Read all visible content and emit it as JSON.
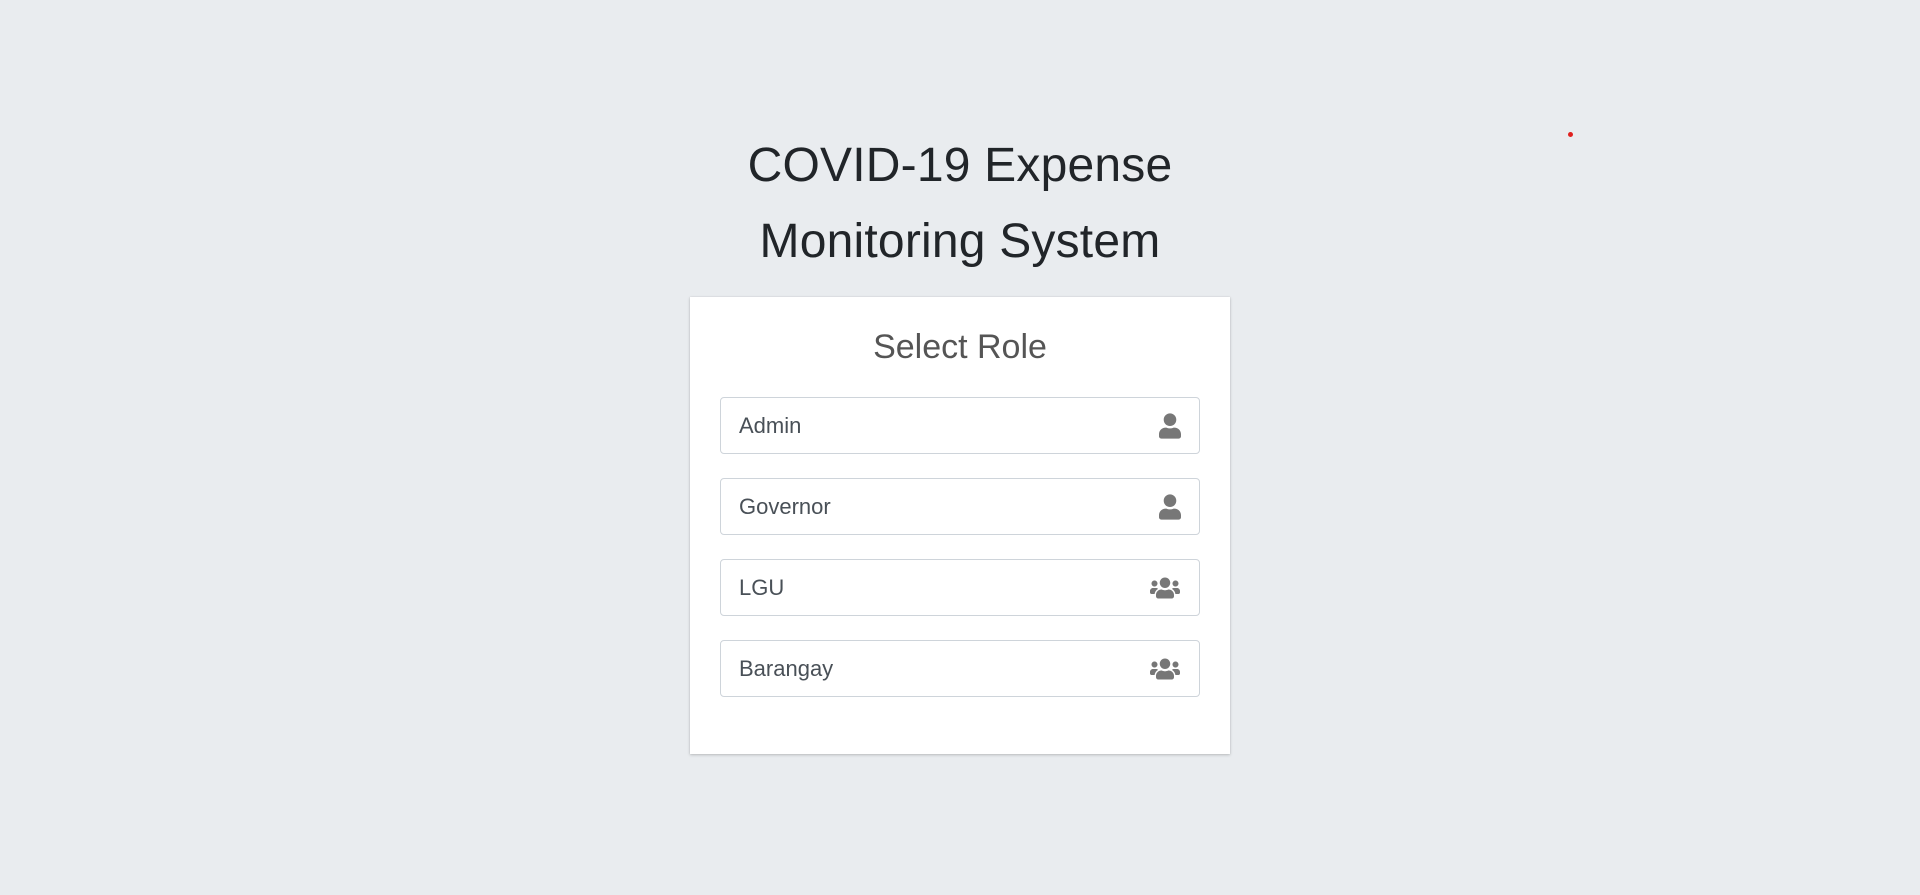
{
  "header": {
    "title_line1": "COVID-19 Expense",
    "title_line2": "Monitoring System"
  },
  "card": {
    "title": "Select Role"
  },
  "roles": [
    {
      "label": "Admin",
      "icon": "user-icon"
    },
    {
      "label": "Governor",
      "icon": "user-icon"
    },
    {
      "label": "LGU",
      "icon": "users-icon"
    },
    {
      "label": "Barangay",
      "icon": "users-icon"
    }
  ],
  "colors": {
    "background": "#e9ecef",
    "card": "#ffffff",
    "icon": "#777777",
    "dot": "#e0201e"
  }
}
